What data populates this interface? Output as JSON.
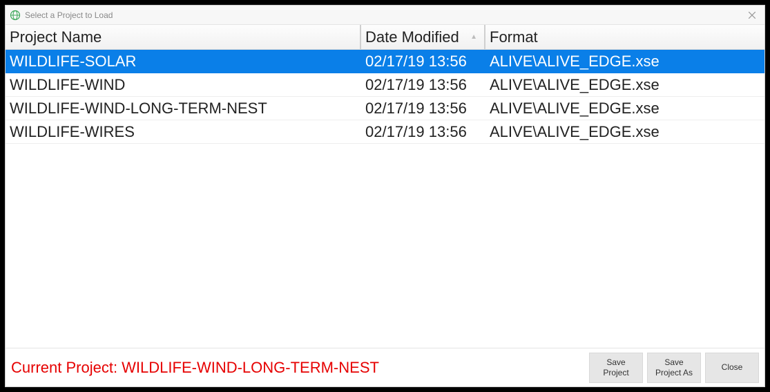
{
  "window": {
    "title": "Select a Project to Load"
  },
  "table": {
    "headers": {
      "name": "Project Name",
      "date": "Date Modified",
      "format": "Format"
    },
    "rows": [
      {
        "name": "WILDLIFE-SOLAR",
        "date": "02/17/19 13:56",
        "format": "ALIVE\\ALIVE_EDGE.xse",
        "selected": true
      },
      {
        "name": "WILDLIFE-WIND",
        "date": "02/17/19 13:56",
        "format": "ALIVE\\ALIVE_EDGE.xse",
        "selected": false
      },
      {
        "name": "WILDLIFE-WIND-LONG-TERM-NEST",
        "date": "02/17/19 13:56",
        "format": "ALIVE\\ALIVE_EDGE.xse",
        "selected": false
      },
      {
        "name": "WILDLIFE-WIRES",
        "date": "02/17/19 13:56",
        "format": "ALIVE\\ALIVE_EDGE.xse",
        "selected": false
      }
    ]
  },
  "footer": {
    "current_prefix": "Current Project: ",
    "current_project": "WILDLIFE-WIND-LONG-TERM-NEST",
    "buttons": {
      "save": "Save Project",
      "save_as": "Save Project As",
      "close": "Close"
    }
  }
}
